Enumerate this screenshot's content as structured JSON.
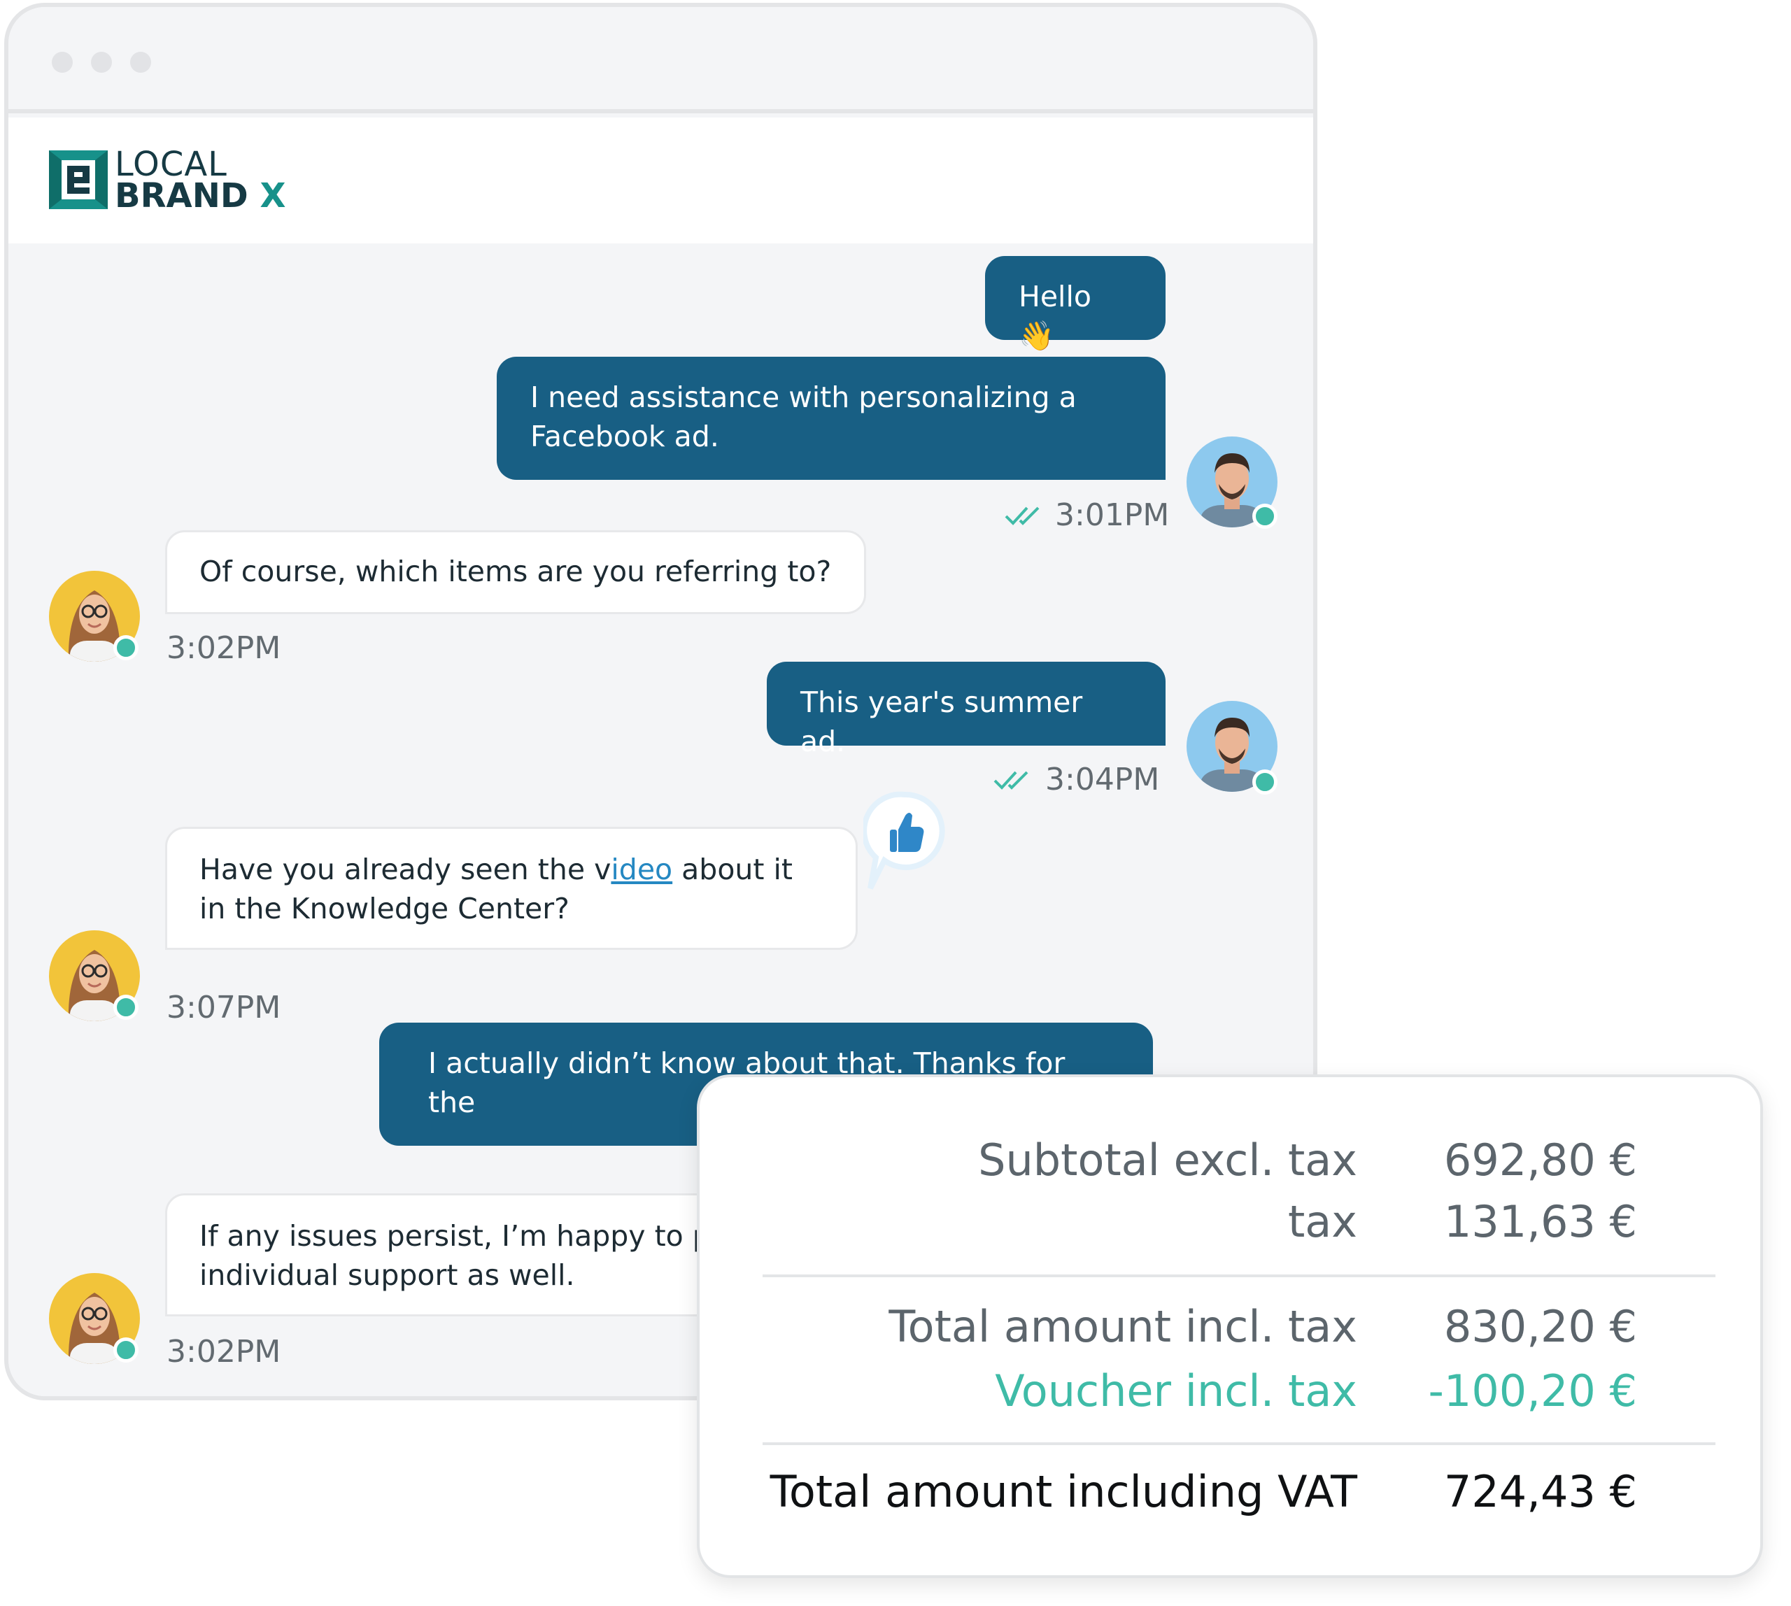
{
  "brand": {
    "logo_line1": "LOCAL",
    "logo_line2": "BRAND",
    "logo_x": "X",
    "primary_color": "#185f84",
    "accent_color": "#3fbba7"
  },
  "messages": [
    {
      "from": "user",
      "text": "Hello 👋"
    },
    {
      "from": "user",
      "text": "I need assistance with personalizing a Facebook ad.",
      "lines": [
        "I need assistance with personalizing a",
        "Facebook ad."
      ],
      "time": "3:01PM",
      "read": true
    },
    {
      "from": "agent",
      "text": "Of course, which items are you referring to?",
      "time": "3:02PM"
    },
    {
      "from": "user",
      "text": "This year's summer ad.",
      "time": "3:04PM",
      "read": true
    },
    {
      "from": "agent",
      "text_before": "Have you already seen the v",
      "link": "ideo",
      "text_after": " about it",
      "line2": "in the Knowledge Center?",
      "time": "3:07PM",
      "reaction": "thumbs-up"
    },
    {
      "from": "user",
      "text": "I actually didn’t know about that. Thanks for the"
    },
    {
      "from": "agent",
      "lines": [
        "If any issues persist, I’m happy to p",
        "individual support as well."
      ],
      "time": "3:02PM"
    }
  ],
  "invoice": {
    "subtotal_label": "Subtotal excl. tax",
    "subtotal_value": "692,80 €",
    "tax_label": "tax",
    "tax_value": "131,63 €",
    "total_label": "Total amount incl. tax",
    "total_value": "830,20 €",
    "voucher_label": "Voucher incl. tax",
    "voucher_value": "-100,20 €",
    "grand_label": "Total amount including VAT",
    "grand_value": "724,43 €"
  }
}
